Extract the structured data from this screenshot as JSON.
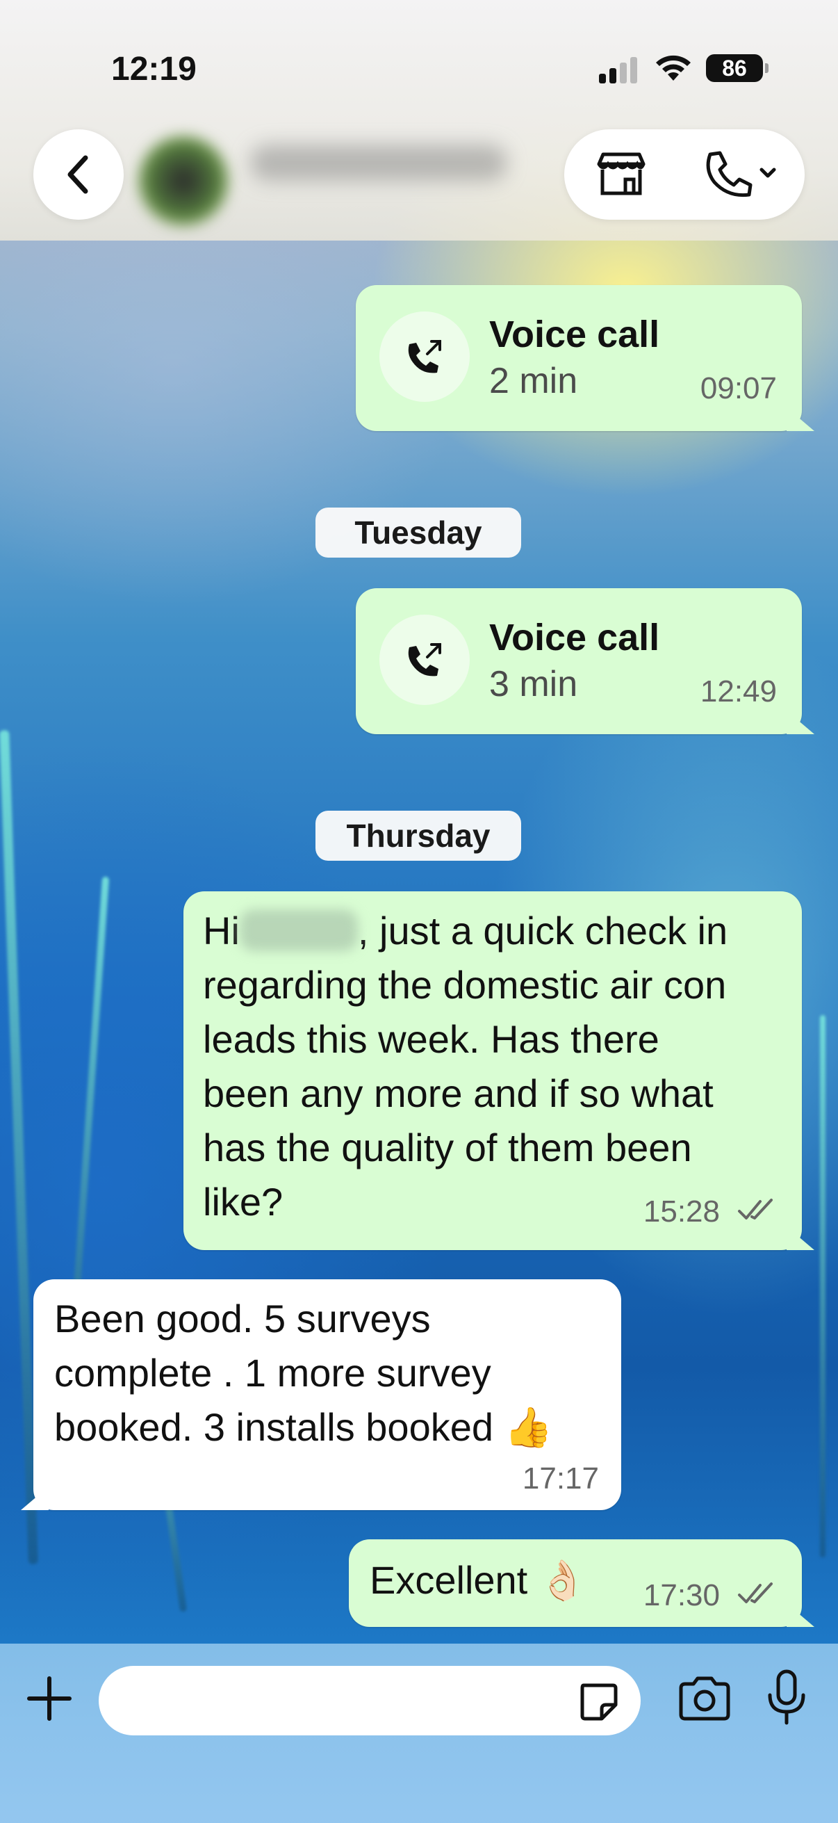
{
  "status_bar": {
    "time": "12:19",
    "battery": "86",
    "icons": [
      "signal-icon",
      "wifi-icon",
      "battery-icon"
    ]
  },
  "header": {
    "back_icon": "chevron-left-icon",
    "actions": [
      "store-icon",
      "phone-icon",
      "chevron-down-icon"
    ]
  },
  "messages": [
    {
      "type": "call",
      "direction": "out",
      "title": "Voice call",
      "duration": "2 min",
      "time": "09:07"
    },
    {
      "type": "date",
      "label": "Tuesday"
    },
    {
      "type": "call",
      "direction": "out",
      "title": "Voice call",
      "duration": "3 min",
      "time": "12:49"
    },
    {
      "type": "date",
      "label": "Thursday"
    },
    {
      "type": "text",
      "direction": "out",
      "lines": [
        {
          "pre": "Hi",
          "post": ", just a quick check in"
        },
        "regarding the domestic air con",
        "leads this week. Has there",
        "been any more and if so what",
        "has the quality of them been",
        "like?"
      ],
      "time": "15:28",
      "status": "read"
    },
    {
      "type": "text",
      "direction": "in",
      "lines": [
        "Been good. 5 surveys",
        "complete . 1 more survey",
        "booked. 3 installs booked 👍"
      ],
      "time": "17:17"
    },
    {
      "type": "text",
      "direction": "out",
      "text": "Excellent 👌🏻",
      "time": "17:30",
      "status": "read"
    }
  ],
  "composer": {
    "placeholder": "",
    "icons": [
      "plus-icon",
      "sticker-icon",
      "camera-icon",
      "microphone-icon"
    ]
  },
  "colors": {
    "outgoing_bubble": "#d9fdd3",
    "incoming_bubble": "#ffffff",
    "read_ticks": "#666666"
  }
}
